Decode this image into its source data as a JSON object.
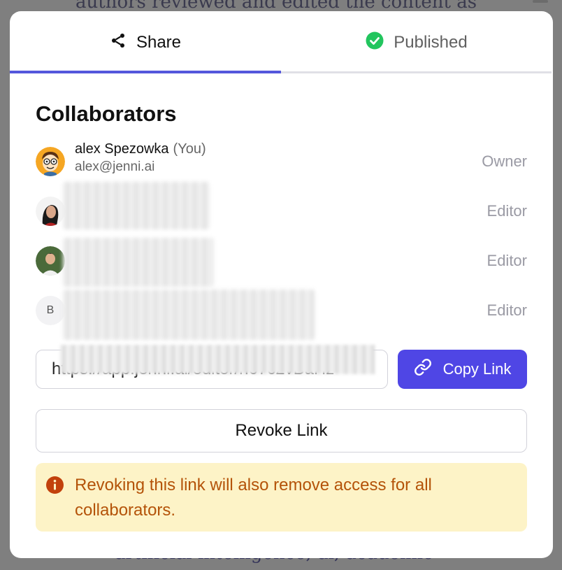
{
  "background": {
    "top_text": "authors reviewed and edited the content as",
    "bottom_text": "artificial intelligence, ai, academic"
  },
  "tabs": [
    {
      "label": "Share",
      "icon": "share-icon",
      "active": true
    },
    {
      "label": "Published",
      "icon": "check-circle-icon",
      "active": false
    }
  ],
  "collaborators": {
    "title": "Collaborators",
    "items": [
      {
        "name": "alex Spezowka",
        "you_label": "(You)",
        "email": "alex@jenni.ai",
        "role": "Owner",
        "avatar": "cartoon-avatar"
      },
      {
        "role": "Editor",
        "avatar": "photo-avatar"
      },
      {
        "role": "Editor",
        "avatar": "photo-avatar"
      },
      {
        "role": "Editor",
        "avatar_letter": "B"
      }
    ]
  },
  "share_link": {
    "value": "https://app.jenni.ai/editor/h67c2vBaHz",
    "copy_label": "Copy Link"
  },
  "revoke": {
    "label": "Revoke Link"
  },
  "warning": {
    "text": "Revoking this link will also remove access for all collaborators."
  },
  "colors": {
    "accent": "#4f46e5",
    "tab_indicator": "#5457dc",
    "published_check": "#22c55e",
    "warning_bg": "#fdf3c7",
    "warning_text": "#b45309"
  }
}
